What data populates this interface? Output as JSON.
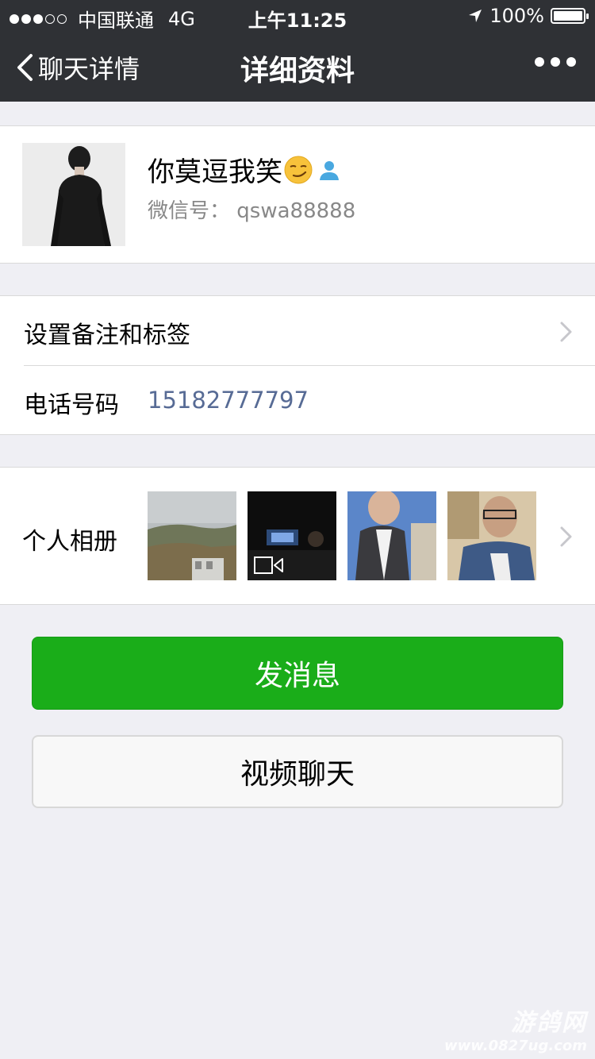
{
  "status_bar": {
    "signal_dots_on": 3,
    "signal_dots_off": 2,
    "carrier": "中国联通",
    "network": "4G",
    "time": "上午11:25",
    "battery_percent": "100%",
    "battery_level": 1.0
  },
  "nav": {
    "back_label": "聊天详情",
    "title": "详细资料"
  },
  "profile": {
    "name": "你莫逗我笑",
    "wechat_id_label": "微信号：",
    "wechat_id": "qswa88888"
  },
  "list": {
    "remark_label": "设置备注和标签",
    "phone_label": "电话号码",
    "phone_value": "15182777797"
  },
  "album": {
    "label": "个人相册"
  },
  "buttons": {
    "send_message": "发消息",
    "video_chat": "视频聊天"
  },
  "watermark": {
    "line1": "游鸽网",
    "line2": "www.0827ug.com"
  },
  "colors": {
    "nav_bg": "#2f3135",
    "primary_green": "#1aad19",
    "link_blue": "#576b95",
    "page_bg": "#efeff4"
  }
}
